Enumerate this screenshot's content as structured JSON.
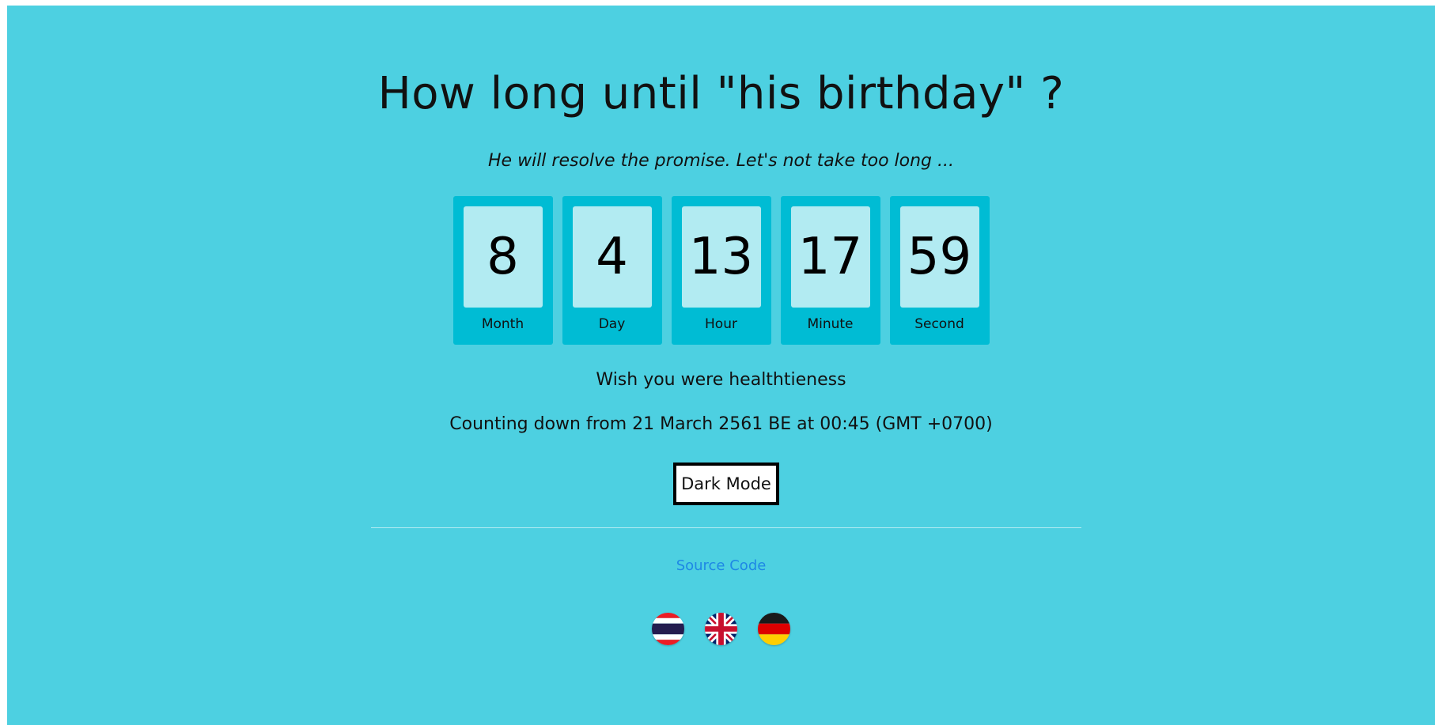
{
  "header": {
    "title": "How long until \"his birthday\" ?",
    "subtitle": "He will resolve the promise. Let's not take too long ..."
  },
  "countdown": [
    {
      "value": "8",
      "label": "Month"
    },
    {
      "value": "4",
      "label": "Day"
    },
    {
      "value": "13",
      "label": "Hour"
    },
    {
      "value": "17",
      "label": "Minute"
    },
    {
      "value": "59",
      "label": "Second"
    }
  ],
  "messages": {
    "wish": "Wish you were healthtieness",
    "counting_from": "Counting down from 21 March 2561 BE at 00:45 (GMT +0700)"
  },
  "controls": {
    "dark_mode_label": "Dark Mode"
  },
  "footer": {
    "source_code_label": "Source Code"
  },
  "languages": [
    {
      "name": "thai-flag-icon"
    },
    {
      "name": "uk-flag-icon"
    },
    {
      "name": "germany-flag-icon"
    }
  ],
  "colors": {
    "background": "#4dd0e1",
    "card": "#00bcd4",
    "digit_box": "#b2ebf2",
    "link": "#1e88e5"
  }
}
